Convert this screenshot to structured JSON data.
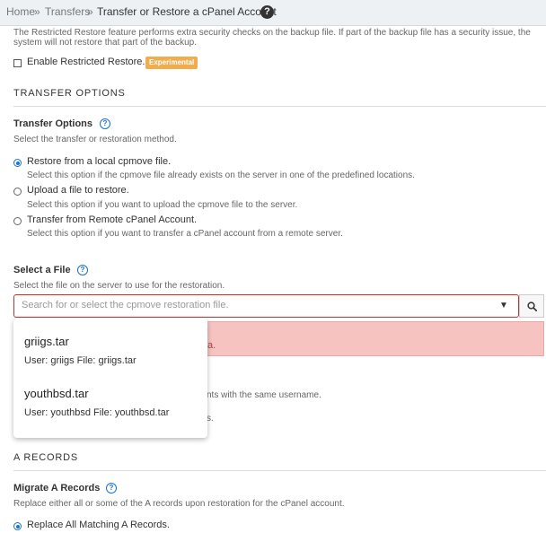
{
  "breadcrumb": {
    "home": "Home",
    "sep1": "»",
    "transfers": "Transfers",
    "sep2": "»",
    "current": "Transfer or Restore a cPanel Account",
    "help": "?"
  },
  "restricted": {
    "description_line1": "The Restricted Restore feature performs extra security checks on the backup file. If part of the backup file has a security issue, the",
    "description_line2": "system will not restore that part of the backup.",
    "checkbox_label": "Enable Restricted Restore.",
    "badge": "Experimental"
  },
  "transfer_section": {
    "title": "TRANSFER OPTIONS",
    "label": "Transfer Options",
    "help": "?",
    "description": "Select the transfer or restoration method.",
    "options": [
      {
        "label": "Restore from a local cpmove file.",
        "hint": "Select this option if the cpmove file already exists on the server in one of the predefined locations."
      },
      {
        "label": "Upload a file to restore.",
        "hint": "Select this option if you want to upload the cpmove file to the server."
      },
      {
        "label": "Transfer from Remote cPanel Account.",
        "hint": "Select this option if you want to transfer a cPanel account from a remote server."
      }
    ]
  },
  "select_file": {
    "label": "Select a File",
    "help": "?",
    "description": "Select the file on the server to use for the restoration.",
    "search_placeholder": "Search for or select the cpmove restoration file.",
    "search_value": "",
    "caret": "▼",
    "error_fragment": "a.",
    "partial_text_1": "nts with the same username.",
    "partial_text_2": "s.",
    "dropdown": [
      {
        "name": "griigs.tar",
        "meta": "User: griigs File: griigs.tar"
      },
      {
        "name": "youthbsd.tar",
        "meta": "User: youthbsd File: youthbsd.tar"
      }
    ]
  },
  "a_records": {
    "title": "A RECORDS",
    "label": "Migrate A Records",
    "help": "?",
    "description": "Replace either all or some of the A records upon restoration for the cPanel account.",
    "option": "Replace All Matching A Records."
  },
  "colors": {
    "accent": "#1a73c8",
    "error_border": "#c9302c",
    "error_bg": "#f6c3c1",
    "badge": "#f0ad4e"
  }
}
